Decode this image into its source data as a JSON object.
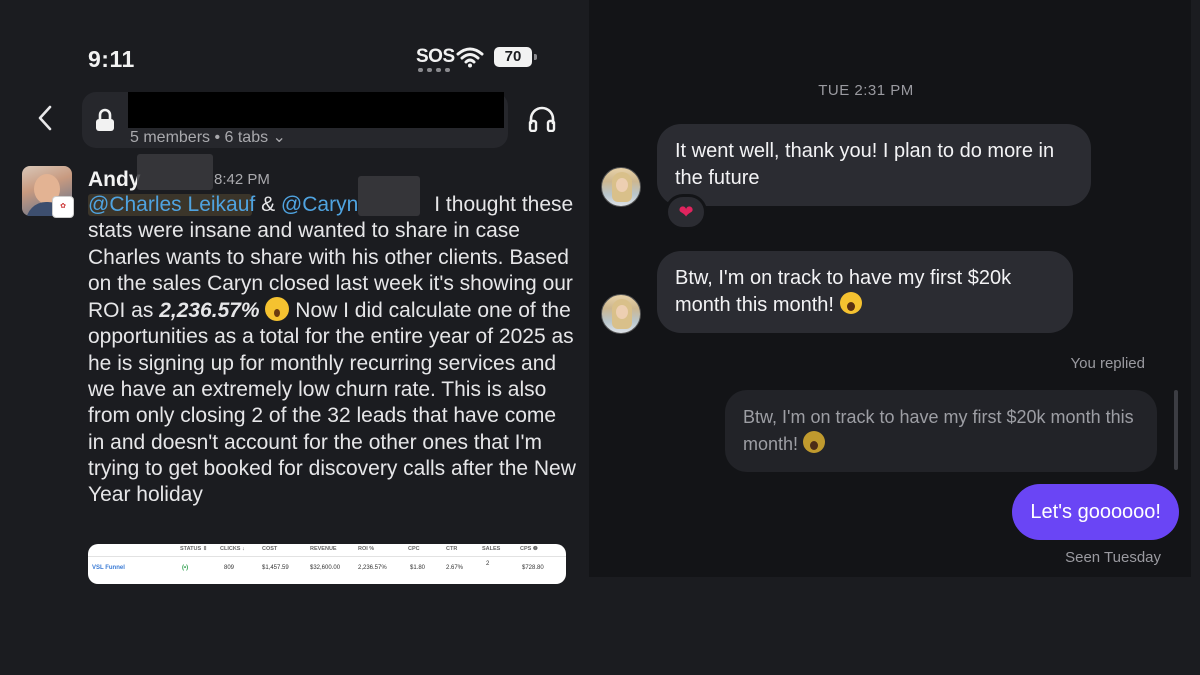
{
  "status_bar": {
    "time": "9:11",
    "sos": "SOS",
    "battery": "70"
  },
  "channel": {
    "meta": "5 members • 6 tabs ⌄"
  },
  "message": {
    "author": "Andy",
    "timestamp": "8:42 PM",
    "mention1": "@Charles Leikauf",
    "amp": " & ",
    "mention2": "@Caryn",
    "text_before_roi": "I thought these stats were insane and wanted to share in case Charles wants to share with his other clients. Based on the sales Caryn closed last week it's showing our ROI as ",
    "roi": "2,236.57%",
    "text_after_roi": " Now I did calculate one of the opportunities as a total for the entire year of 2025 as he is signing up for monthly recurring services and we have an extremely low churn rate. This is also from only closing 2 of the 32 leads that have come in and doesn't account for the other ones that I'm trying to get booked for discovery calls after the New Year holiday"
  },
  "stats_table": {
    "headers": [
      "STATUS ⇕",
      "CLICKS ↓",
      "COST",
      "REVENUE",
      "ROI %",
      "CPC",
      "CTR",
      "SALES",
      "CPS ❷"
    ],
    "row": {
      "name": "VSL Funnel",
      "status": "(•)",
      "clicks": "809",
      "cost": "$1,457.59",
      "revenue": "$32,600.00",
      "roi": "2,236.57%",
      "cpc": "$1.80",
      "ctr": "2.67%",
      "sales": "2",
      "cps": "$728.80"
    }
  },
  "dm": {
    "date_label": "TUE 2:31 PM",
    "message1": "It went well, thank you! I plan to do more in the future",
    "reaction": "❤",
    "message2": "Btw, I'm on track to have my first $20k month this month!",
    "you_replied": "You replied",
    "quoted": "Btw, I'm on track to have my first $20k month this month!",
    "sent": "Let's goooooo!",
    "seen": "Seen Tuesday"
  }
}
